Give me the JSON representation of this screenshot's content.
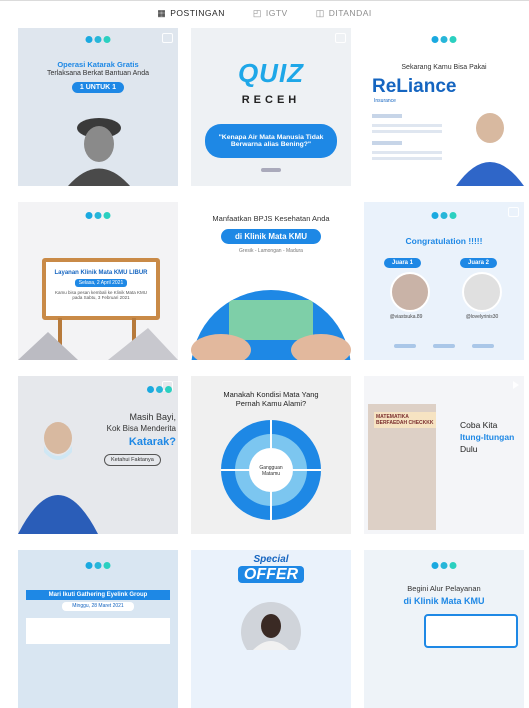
{
  "tabs": [
    {
      "label": "POSTINGAN",
      "icon": "grid-icon",
      "active": true
    },
    {
      "label": "IGTV",
      "icon": "igtv-icon",
      "active": false
    },
    {
      "label": "DITANDAI",
      "icon": "tag-icon",
      "active": false
    }
  ],
  "posts": {
    "p1": {
      "line1": "Operasi Katarak Gratis",
      "line2": "Terlaksana Berkat Bantuan Anda",
      "badge": "1 UNTUK 1"
    },
    "p2": {
      "title": "QUIZ",
      "subtitle": "RECEH",
      "question": "\"Kenapa Air Mata Manusia Tidak Berwarna alias Bening?\""
    },
    "p3": {
      "heading": "Sekarang Kamu Bisa Pakai",
      "brand": "ReLiance",
      "brand_sub": "Insurance"
    },
    "p4": {
      "sign_title": "Layanan Klinik Mata KMU LIBUR",
      "sign_date": "Selasa, 2 April 2021",
      "sign_body": "Kamu bisa pesan kembali ke Klinik Mata KMU pada Sabtu, 3 Februari 2021"
    },
    "p5": {
      "heading": "Manfaatkan BPJS Kesehatan Anda",
      "badge": "di Klinik Mata KMU",
      "sub": "Gresik - Lamongan - Madura"
    },
    "p6": {
      "heading": "Congratulation !!!!!",
      "winner1_label": "Juara 1",
      "winner2_label": "Juara 2",
      "winner1_name": "@viastsuka.89",
      "winner2_name": "@lovelyrinis30"
    },
    "p7": {
      "line1": "Masih Bayi,",
      "line2": "Kok Bisa Menderita",
      "line3": "Katarak?",
      "cta": "Ketahui Faktanya"
    },
    "p8": {
      "heading": "Manakah Kondisi Mata Yang Pernah Kamu Alami?",
      "center": "Gangguan Matamu"
    },
    "p9": {
      "book": "MATEMATIKA BERFAEDAH CHECKKK",
      "line1": "Coba Kita",
      "line2": "Itung-Itungan",
      "line3": "Dulu"
    },
    "p10": {
      "banner": "Mari Ikuti Gathering Eyelink Group",
      "date": "Minggu, 28 Maret 2021"
    },
    "p11": {
      "badge1": "Special",
      "badge2": "OFFER"
    },
    "p12": {
      "line1": "Begini Alur Pelayanan",
      "line2": "di Klinik Mata KMU"
    }
  },
  "colors": {
    "accent": "#1e88e5",
    "muted": "#8e8e8e"
  }
}
